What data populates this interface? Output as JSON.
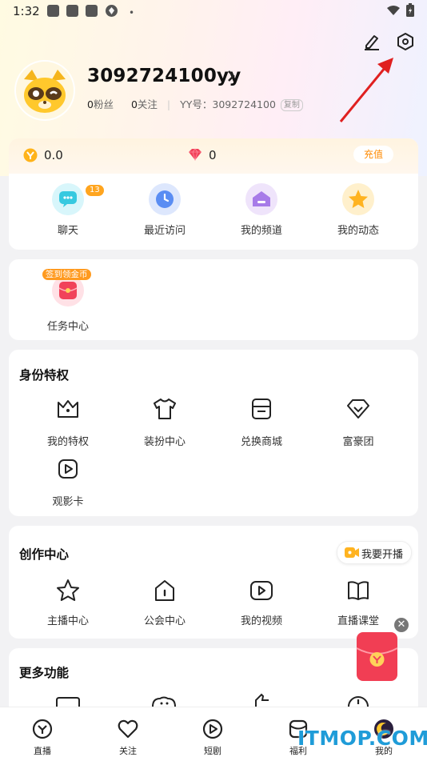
{
  "status_bar": {
    "time": "1:32",
    "dot": "•"
  },
  "profile": {
    "username": "3092724100yy",
    "fans_count": "0",
    "fans_label": "粉丝",
    "follow_count": "0",
    "follow_label": "关注",
    "yy_label": "YY号：",
    "yy_id": "3092724100",
    "copy_label": "复制"
  },
  "wallet": {
    "coins": "0.0",
    "gems": "0",
    "recharge_label": "充值"
  },
  "quick_menu": [
    {
      "label": "聊天",
      "badge": "13",
      "icon": "chat-icon",
      "color": "#36c9e0"
    },
    {
      "label": "最近访问",
      "icon": "clock-icon",
      "color": "#5a8df3"
    },
    {
      "label": "我的频道",
      "icon": "channel-icon",
      "color": "#a77be8"
    },
    {
      "label": "我的动态",
      "icon": "star-icon",
      "color": "#ffb320"
    }
  ],
  "task": {
    "badge": "签到领金币",
    "label": "任务中心"
  },
  "identity": {
    "title": "身份特权",
    "items": [
      {
        "label": "我的特权",
        "icon": "crown-icon"
      },
      {
        "label": "装扮中心",
        "icon": "tshirt-icon"
      },
      {
        "label": "兑换商城",
        "icon": "store-icon"
      },
      {
        "label": "富豪团",
        "icon": "diamond-icon"
      },
      {
        "label": "观影卡",
        "icon": "play-card-icon"
      }
    ]
  },
  "creation": {
    "title": "创作中心",
    "live_button": "我要开播",
    "items": [
      {
        "label": "主播中心",
        "icon": "star-outline-icon"
      },
      {
        "label": "公会中心",
        "icon": "home-icon"
      },
      {
        "label": "我的视频",
        "icon": "video-icon"
      },
      {
        "label": "直播课堂",
        "icon": "book-icon"
      }
    ]
  },
  "more": {
    "title": "更多功能"
  },
  "tabbar": [
    {
      "label": "直播",
      "icon": "live-tab-icon"
    },
    {
      "label": "关注",
      "icon": "heart-tab-icon"
    },
    {
      "label": "短剧",
      "icon": "play-tab-icon"
    },
    {
      "label": "福利",
      "icon": "mail-tab-icon"
    },
    {
      "label": "我的",
      "icon": "me-tab-icon"
    }
  ],
  "watermark": "ITMOP.COM",
  "colors": {
    "accent": "#ff8a00",
    "badge": "#ffa51f",
    "arrow": "#e02020",
    "watermark": "#1f9cd8"
  }
}
